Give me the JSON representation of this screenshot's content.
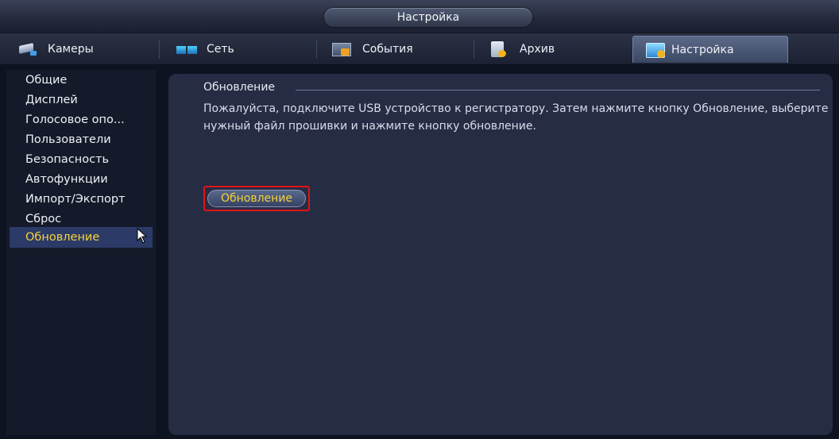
{
  "window": {
    "title": "Настройка"
  },
  "tabs": [
    {
      "label": "Камеры",
      "icon": "camera-icon"
    },
    {
      "label": "Сеть",
      "icon": "network-icon"
    },
    {
      "label": "События",
      "icon": "events-icon"
    },
    {
      "label": "Архив",
      "icon": "archive-icon"
    },
    {
      "label": "Настройка",
      "icon": "settings-icon",
      "active": true
    }
  ],
  "sidebar": {
    "items": [
      {
        "label": "Общие"
      },
      {
        "label": "Дисплей"
      },
      {
        "label": "Голосовое опо..."
      },
      {
        "label": "Пользователи"
      },
      {
        "label": "Безопасность"
      },
      {
        "label": "Автофункции"
      },
      {
        "label": "Импорт/Экспорт"
      },
      {
        "label": "Сброс"
      },
      {
        "label": "Обновление",
        "active": true
      }
    ]
  },
  "main": {
    "section_title": "Обновление",
    "info_text": "Пожалуйста, подключите USB устройство к регистратору. Затем нажмите кнопку Обновление, выберите нужный файл прошивки и нажмите кнопку обновление.",
    "update_button_label": "Обновление"
  },
  "colors": {
    "active_text": "#f7d23a",
    "highlight_border": "#e01414",
    "panel_bg": "#272c45",
    "sidebar_active_bg": "#2b3a66"
  }
}
